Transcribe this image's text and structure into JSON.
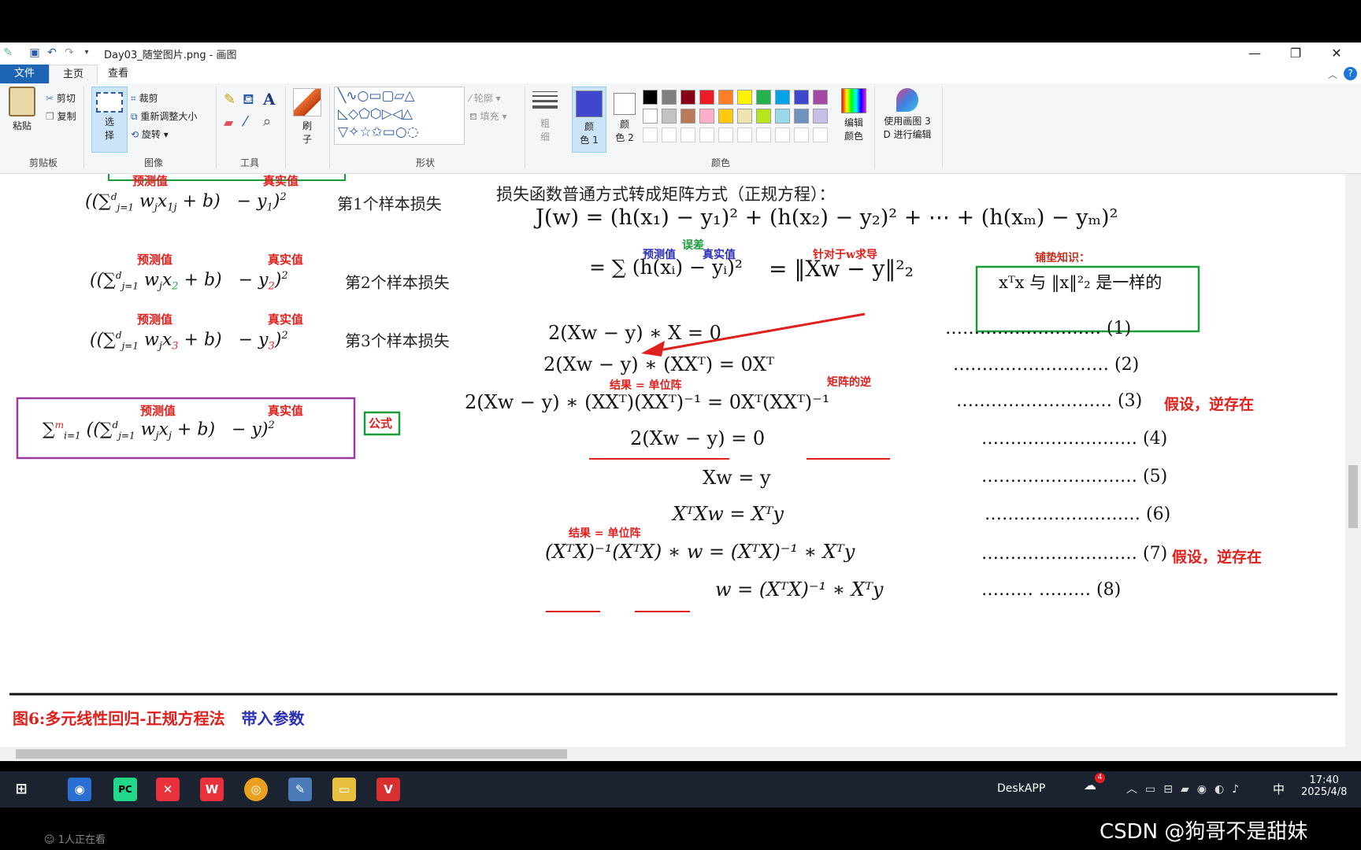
{
  "window": {
    "title": "Day03_随堂图片.png - 画图",
    "minimize": "—",
    "restore": "❐",
    "close": "✕",
    "help": "?"
  },
  "tabs": {
    "file": "文件",
    "home": "主页",
    "view": "查看"
  },
  "ribbon": {
    "clipboard": {
      "paste": "粘贴",
      "cut": "剪切",
      "copy": "复制",
      "label": "剪贴板"
    },
    "image": {
      "select": "选",
      "select2": "择",
      "crop": "裁剪",
      "resize": "重新调整大小",
      "rotate": "旋转",
      "label": "图像"
    },
    "tools": {
      "label": "工具"
    },
    "brush": {
      "label1": "刷",
      "label2": "子"
    },
    "shapes": {
      "outline": "轮廓",
      "fill": "填充",
      "label": "形状"
    },
    "size": {
      "l1": "粗",
      "l2": "细"
    },
    "color1": {
      "l1": "颜",
      "l2": "色 1"
    },
    "color2": {
      "l1": "颜",
      "l2": "色 2"
    },
    "edit_colors": {
      "l1": "编辑",
      "l2": "颜色"
    },
    "paint3d": {
      "l1": "使用画图 3",
      "l2": "D 进行编辑"
    },
    "colors_label": "颜色",
    "palette_row1": [
      "#000000",
      "#7f7f7f",
      "#880015",
      "#ed1c24",
      "#ff7f27",
      "#fff200",
      "#22b14c",
      "#00a2e8",
      "#3f48cc",
      "#a349a4"
    ],
    "palette_row2": [
      "#ffffff",
      "#c3c3c3",
      "#b97a57",
      "#ffaec9",
      "#ffc90e",
      "#efe4b0",
      "#b5e61d",
      "#99d9ea",
      "#7092be",
      "#c8bfe7"
    ],
    "color1_value": "#3f48cc",
    "color2_value": "#ffffff"
  },
  "canvas": {
    "label_pred": "预测值",
    "label_true": "真实值",
    "row1": {
      "expr": "((∑ w x + b)  − y )",
      "j": "j=1",
      "d": "d",
      "sub1": "j",
      "sub2": "1j",
      "y": "1",
      "exp": "2",
      "desc": "第1个样本损失"
    },
    "row2": {
      "sub2": "2",
      "y": "2",
      "desc": "第2个样本损失"
    },
    "row3": {
      "sub2": "3",
      "y": "3",
      "desc": "第3个样本损失",
      "num": "3"
    },
    "formula_tag": "公式",
    "sum_m": "m",
    "sum_i": "i=1",
    "heading": "损失函数普通方式转成矩阵方式（正规方程）：",
    "heading_red": "转成矩阵",
    "jw": "J(w) = (h(x₁) − y₁)² + (h(x₂) − y₂)² + ⋯ + (h(xₘ) − yₘ)²",
    "eq_sum": "= ∑ (h(xᵢ) − yᵢ)²",
    "eq_norm": "=  ‖Xw − y‖²₂",
    "err_label": "误差",
    "deriv_label": "针对于w求导",
    "knowledge_title": "铺垫知识：",
    "knowledge_body": "xᵀx 与 ‖x‖²₂ 是一样的",
    "steps": [
      {
        "expr": "2(Xw − y) ∗ X =  0",
        "num": "……………………… (1)"
      },
      {
        "expr": "2(Xw − y) ∗ (XXᵀ) =  0Xᵀ",
        "num": "……………………… (2)"
      },
      {
        "expr": "2(Xw − y) ∗ (XXᵀ)(XXᵀ)⁻¹ =  0Xᵀ(XXᵀ)⁻¹",
        "num": "……………………… (3)",
        "note": "假设，逆存在"
      },
      {
        "expr": "2(Xw − y) = 0",
        "num": "……………………… (4)"
      },
      {
        "expr": "Xw = y",
        "num": "……………………… (5)"
      },
      {
        "expr": "XᵀXw = Xᵀy",
        "num": "……………………… (6)"
      },
      {
        "expr": "(XᵀX)⁻¹(XᵀX) ∗ w =  (XᵀX)⁻¹ ∗ Xᵀy",
        "num": "……………………… (7)",
        "note": "假设，逆存在"
      },
      {
        "expr": "w =  (XᵀX)⁻¹ ∗ Xᵀy",
        "num": "………  ……… (8)"
      }
    ],
    "unit_label": "结果 = 单位阵",
    "inverse_label": "矩阵的逆",
    "caption_red": "图6:多元线性回归-正规方程法",
    "caption_blue": "带入参数"
  },
  "taskbar": {
    "deskapp": "DeskAPP",
    "time": "17:40",
    "date": "2025/4/8",
    "ime": "中",
    "badge": "4"
  },
  "footer": {
    "viewers": "1人正在看",
    "watermark": "CSDN @狗哥不是甜妹"
  }
}
